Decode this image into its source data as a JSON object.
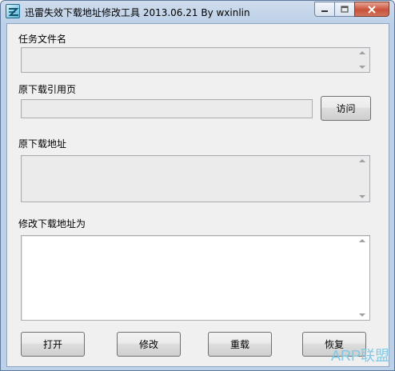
{
  "window": {
    "title": "迅雷失效下载地址修改工具     2013.06.21  By wxinlin"
  },
  "caption": {
    "minimize": "minimize-icon",
    "maximize": "maximize-icon",
    "close": "close-icon"
  },
  "fields": {
    "task_filename_label": "任务文件名",
    "task_filename_value": "",
    "referer_label": "原下载引用页",
    "referer_value": "",
    "orig_url_label": "原下载地址",
    "orig_url_value": "",
    "new_url_label": "修改下载地址为",
    "new_url_value": ""
  },
  "buttons": {
    "visit": "访问",
    "open": "打开",
    "modify": "修改",
    "reload": "重载",
    "restore": "恢复"
  },
  "watermark": "ARP联盟",
  "colors": {
    "titlebar": "#bcd0e8",
    "client": "#f0f0f0",
    "close": "#c8523a"
  }
}
